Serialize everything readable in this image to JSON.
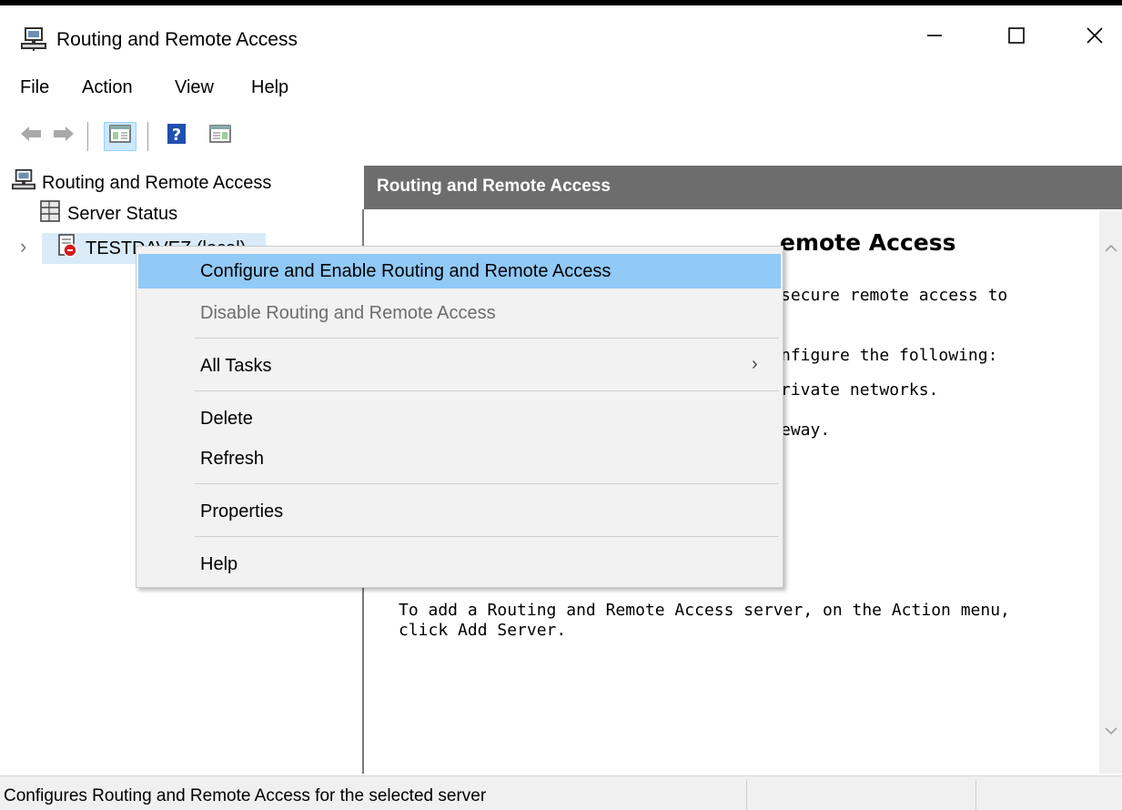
{
  "window": {
    "title": "Routing and Remote Access",
    "icon": "server-computer-icon",
    "controls": [
      "minimize-icon",
      "maximize-icon",
      "close-icon"
    ]
  },
  "menubar": {
    "items": [
      "File",
      "Action",
      "View",
      "Help"
    ]
  },
  "toolbar": {
    "buttons": [
      "back-arrow-icon",
      "forward-arrow-icon",
      "show-hide-console-tree-icon",
      "help-icon",
      "show-hide-action-pane-icon"
    ]
  },
  "tree": {
    "root": "Routing and Remote Access",
    "children": [
      {
        "label": "Server Status",
        "icon": "server-status-icon"
      },
      {
        "label": "TESTDAVEZ (local)",
        "visible_label": "TESTDAVEZ (local)",
        "icon": "server-stopped-icon",
        "selected": true
      }
    ]
  },
  "result": {
    "header": "Routing and Remote Access",
    "heading_visible": "emote Access",
    "lines": [
      "secure remote access to",
      "nfigure the following:",
      "rivate networks.",
      "eway."
    ],
    "footer_line1": "To add a Routing and Remote Access server, on the Action menu,",
    "footer_line2": "click Add Server."
  },
  "context_menu": {
    "items": [
      {
        "label": "Configure and Enable Routing and Remote Access",
        "state": "hover"
      },
      {
        "label": "Disable Routing and Remote Access",
        "state": "disabled"
      },
      {
        "label": "All Tasks",
        "submenu": true
      },
      {
        "label": "Delete"
      },
      {
        "label": "Refresh"
      },
      {
        "label": "Properties"
      },
      {
        "label": "Help"
      }
    ],
    "submenu_glyph": "›"
  },
  "statusbar": {
    "text": "Configures Routing and Remote Access for the selected server"
  },
  "colors": {
    "menu_hover": "#91c9f7",
    "header_bg": "#6d6d6d",
    "selected_tree": "#d9ebf9",
    "menu_bg": "#f2f2f2"
  }
}
